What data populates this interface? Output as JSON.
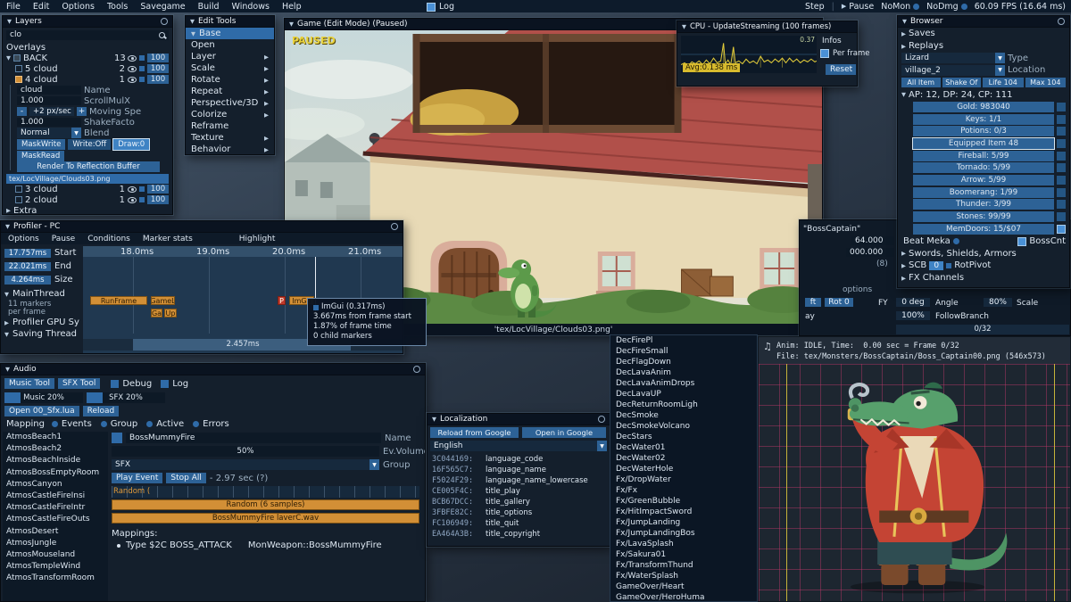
{
  "menubar": {
    "items": [
      "File",
      "Edit",
      "Options",
      "Tools",
      "Savegame",
      "Build",
      "Windows",
      "Help"
    ],
    "log": "Log",
    "step": "Step",
    "pause": "Pause",
    "nomon": "NoMon",
    "nodmg": "NoDmg",
    "fps": "60.09 FPS (16.64 ms)"
  },
  "layers": {
    "title": "Layers",
    "search": "clo",
    "overlays": "Overlays",
    "back": {
      "name": "BACK",
      "count": "13",
      "opacity": "100"
    },
    "children_top": [
      {
        "name": "5 cloud",
        "count": "2",
        "opacity": "100"
      },
      {
        "name": "4 cloud",
        "count": "1",
        "opacity": "100"
      }
    ],
    "props": {
      "name_value": "cloud",
      "name_label": "Name",
      "scroll_value": "1.000",
      "scroll_label": "ScrollMulX",
      "move_minus": "-",
      "move_value": "+2 px/sec",
      "move_plus": "+",
      "move_label": "Moving Spe",
      "shake_value": "1.000",
      "shake_label": "ShakeFacto",
      "blend_value": "Normal",
      "blend_label": "Blend",
      "maskwrite": "MaskWrite",
      "write_off": "Write:Off",
      "draw0": "Draw:0",
      "maskread": "MaskRead",
      "reflection": "Render To Reflection Buffer",
      "texture": "tex/LocVillage/Clouds03.png"
    },
    "children_bottom": [
      {
        "name": "3 cloud",
        "count": "1",
        "opacity": "100"
      },
      {
        "name": "2 cloud",
        "count": "1",
        "opacity": "100"
      }
    ],
    "extra": "Extra"
  },
  "edit_tools": {
    "title": "Edit Tools",
    "selected": "Base",
    "items": [
      {
        "label": "Open",
        "arrow": ""
      },
      {
        "label": "Layer",
        "arrow": "▶"
      },
      {
        "label": "Scale",
        "arrow": "▶"
      },
      {
        "label": "Rotate",
        "arrow": "▶"
      },
      {
        "label": "Repeat",
        "arrow": "▶"
      },
      {
        "label": "Perspective/3D",
        "arrow": "▶"
      },
      {
        "label": "Colorize",
        "arrow": "▶"
      },
      {
        "label": "Reframe",
        "arrow": ""
      },
      {
        "label": "Texture",
        "arrow": "▶"
      },
      {
        "label": "Behavior",
        "arrow": "▶"
      }
    ]
  },
  "game": {
    "title": "Game (Edit Mode) (Paused)",
    "paused": "PAUSED",
    "status": "'tex/LocVillage/Clouds03.png'"
  },
  "cpu": {
    "title": "CPU - UpdateStreaming (100 frames)",
    "peak": "0.37",
    "avg": "Avg:0.138 ms",
    "infos": "Infos",
    "per_frame": "Per frame",
    "reset": "Reset"
  },
  "browser": {
    "title": "Browser",
    "saves": "Saves",
    "replays": "Replays",
    "type_value": "Lizard",
    "type_label": "Type",
    "location_value": "village_2",
    "location_label": "Location",
    "buttons": [
      "All Item",
      "Shake Of",
      "Life 104",
      "Max 104"
    ],
    "stats_header": "AP: 12, DP: 24, CP: 111",
    "stats": [
      "Gold: 983040",
      "Keys: 1/1",
      "Potions: 0/3",
      "Equipped Item 48",
      "Fireball: 5/99",
      "Tornado: 5/99",
      "Arrow: 5/99",
      "Boomerang: 1/99",
      "Thunder: 3/99",
      "Stones: 99/99"
    ],
    "memdoors": "MemDoors: 15/$07",
    "beat_meka": "Beat Meka",
    "bosscnt": "BossCnt",
    "swords": "Swords, Shields, Armors",
    "scb": "SCB",
    "scb_value": "0",
    "rotpivot": "RotPivot",
    "fx_channels": "FX Channels"
  },
  "transform": {
    "boss_name": "\"BossCaptain\"",
    "v1": "64.000",
    "v2": "000.000",
    "v3": "(8)",
    "options": "options",
    "ft": "ft",
    "rot": "Rot 0",
    "fy": "FY",
    "deg": "0 deg",
    "angle": "Angle",
    "scale_pct": "80%",
    "scale": "Scale",
    "ay": "ay",
    "pct100": "100%",
    "follow": "FollowBranch",
    "progress": "0/32"
  },
  "profiler": {
    "title": "Profiler - PC",
    "menu": [
      "Options",
      "Pause",
      "Conditions",
      "Marker stats"
    ],
    "highlight": "Highlight",
    "start_value": "17.757ms",
    "start_label": "Start",
    "end_value": "22.021ms",
    "end_label": "End",
    "size_value": "4.264ms",
    "size_label": "Size",
    "ticks": [
      "18.0ms",
      "19.0ms",
      "20.0ms",
      "21.0ms"
    ],
    "mainthread": "MainThread",
    "markers_line1": "11 markers",
    "markers_line2": "per frame",
    "bars": {
      "runframe": "RunFrame",
      "gamel": "GameL",
      "ga": "Ga",
      "up": "Up",
      "p": "P",
      "imgu": "ImGu"
    },
    "tooltip": [
      "ImGui (0.317ms)",
      "3.667ms from frame start",
      "1.87% of frame time",
      "0 child markers"
    ],
    "gpu": "Profiler GPU Sy",
    "saving": "Saving Thread",
    "selection": "2.457ms"
  },
  "audio": {
    "title": "Audio",
    "music_tool": "Music Tool",
    "sfx_tool": "SFX Tool",
    "debug": "Debug",
    "log": "Log",
    "music_vol": "Music 20%",
    "sfx_vol": "SFX 20%",
    "open_btn": "Open 00_Sfx.lua",
    "reload_btn": "Reload",
    "mapping": "Mapping",
    "radios": [
      "Events",
      "Group",
      "Active",
      "Errors"
    ],
    "list": [
      "AtmosBeach1",
      "AtmosBeach2",
      "AtmosBeachInside",
      "AtmosBossEmptyRoom",
      "AtmosCanyon",
      "AtmosCastleFireInsi",
      "AtmosCastleFireIntr",
      "AtmosCastleFireOuts",
      "AtmosDesert",
      "AtmosJungle",
      "AtmosMouseland",
      "AtmosTempleWind",
      "AtmosTransformRoom"
    ],
    "name_value": "BossMummyFire",
    "name_label": "Name",
    "volume_value": "50%",
    "volume_label": "Ev.Volume",
    "group_value": "SFX",
    "group_label": "Group",
    "play": "Play Event",
    "stop": "Stop All",
    "duration": "- 2.97 sec (?)",
    "random_clip": "Random (",
    "random_bar": "Random (6 samples)",
    "wav_bar": "BossMummyFire laverC.wav",
    "mappings_label": "Mappings:",
    "mapping_line": "Type $2C BOSS_ATTACK",
    "mapping_line2": "MonWeapon::BossMummyFire"
  },
  "localization": {
    "title": "Localization",
    "reload": "Reload from Google",
    "open": "Open in Google",
    "language": "English",
    "rows": [
      {
        "hash": "3C044169:",
        "key": "language_code"
      },
      {
        "hash": "16F565C7:",
        "key": "language_name"
      },
      {
        "hash": "F5024F29:",
        "key": "language_name_lowercase"
      },
      {
        "hash": "CE005F4C:",
        "key": "title_play"
      },
      {
        "hash": "BCB67DCC:",
        "key": "title_gallery"
      },
      {
        "hash": "3FBFE82C:",
        "key": "title_options"
      },
      {
        "hash": "FC106949:",
        "key": "title_quit"
      },
      {
        "hash": "EA464A3B:",
        "key": "title_copyright"
      }
    ]
  },
  "filelist": {
    "items": [
      "DecFirePl",
      "DecFireSmall",
      "DecFlagDown",
      "DecLavaAnim",
      "DecLavaAnimDrops",
      "DecLavaUP",
      "DecReturnRoomLigh",
      "DecSmoke",
      "DecSmokeVolcano",
      "DecStars",
      "DecWater01",
      "DecWater02",
      "DecWaterHole",
      "Fx/DropWater",
      "Fx/Fx",
      "Fx/GreenBubble",
      "Fx/HitImpactSword",
      "Fx/JumpLanding",
      "Fx/JumpLandingBos",
      "Fx/LavaSplash",
      "Fx/Sakura01",
      "Fx/TransformThund",
      "Fx/WaterSplash",
      "GameOver/Heart",
      "GameOver/HeroHuma"
    ]
  },
  "sprite": {
    "anim_line": "Anim: IDLE, Time:  0.00 sec = Frame 0/32",
    "file_line": "File: tex/Monsters/BossCaptain/Boss_Captain00.png (546x573)"
  }
}
